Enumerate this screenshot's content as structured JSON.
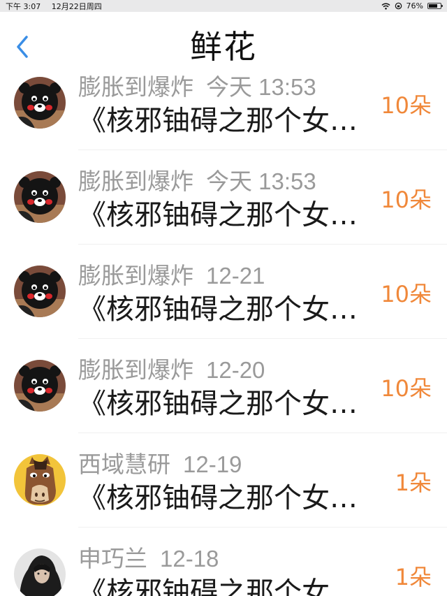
{
  "status_bar": {
    "time": "下午 3:07",
    "date": "12月22日周四",
    "battery": "76%",
    "battery_level": 0.76
  },
  "nav": {
    "title": "鲜花",
    "back_icon": "chevron-left-icon"
  },
  "colors": {
    "accent": "#3a8ee6",
    "count": "#f0883a",
    "name": "#9a9a9a"
  },
  "items": [
    {
      "name": "膨胀到爆炸",
      "date": "今天 13:53",
      "text": "《核邪铀碍之那个女…",
      "count": "10朵",
      "avatar": "kumamon"
    },
    {
      "name": "膨胀到爆炸",
      "date": "今天 13:53",
      "text": "《核邪铀碍之那个女…",
      "count": "10朵",
      "avatar": "kumamon"
    },
    {
      "name": "膨胀到爆炸",
      "date": "12-21",
      "text": "《核邪铀碍之那个女…",
      "count": "10朵",
      "avatar": "kumamon"
    },
    {
      "name": "膨胀到爆炸",
      "date": "12-20",
      "text": "《核邪铀碍之那个女…",
      "count": "10朵",
      "avatar": "kumamon"
    },
    {
      "name": "西域慧研",
      "date": "12-19",
      "text": "《核邪铀碍之那个女…",
      "count": "1朵",
      "avatar": "horse"
    },
    {
      "name": "申巧兰",
      "date": "12-18",
      "text": "《核邪铀碍之那个女…",
      "count": "1朵",
      "avatar": "hooded-person"
    }
  ]
}
